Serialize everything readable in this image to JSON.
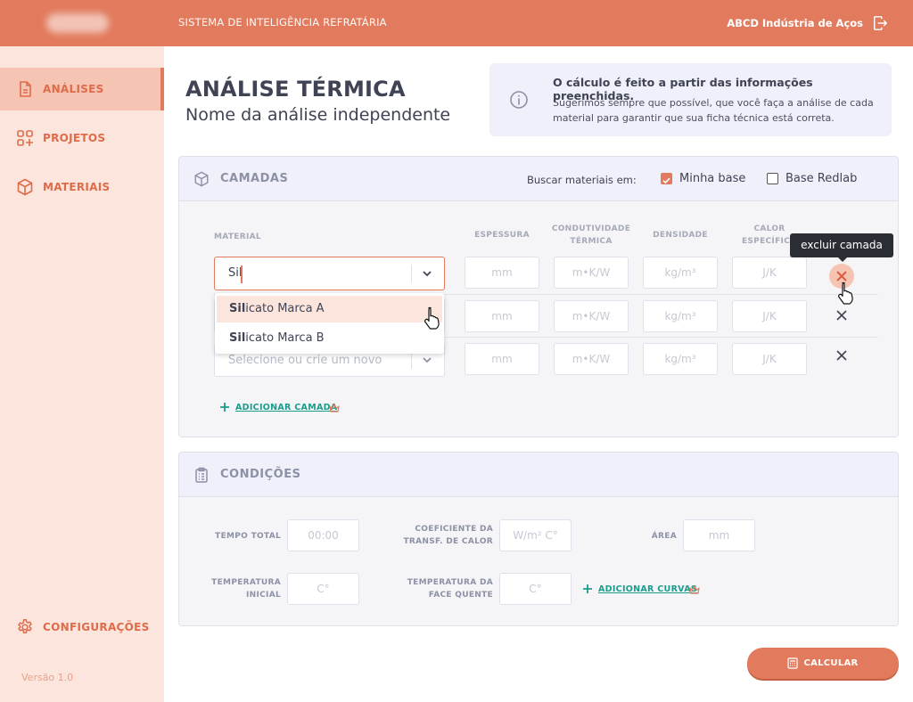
{
  "header": {
    "system_title": "SISTEMA DE INTELIGÊNCIA REFRATÁRIA",
    "company": "ABCD Indústria de Aços"
  },
  "sidebar": {
    "items": [
      {
        "label": "ANÁLISES",
        "icon": "document-icon",
        "active": true
      },
      {
        "label": "PROJETOS",
        "icon": "grid-plus-icon",
        "active": false
      },
      {
        "label": "MATERIAIS",
        "icon": "cube-icon",
        "active": false
      }
    ],
    "settings_label": "CONFIGURAÇÕES",
    "version": "Versão 1.0"
  },
  "page": {
    "title": "ANÁLISE TÉRMICA",
    "subtitle": "Nome da análise independente"
  },
  "info": {
    "title": "O cálculo é feito a partir das informações preenchidas.",
    "text": "Sugerimos sempre que possível, que você faça a análise de cada material para garantir que sua ficha técnica está correta."
  },
  "layers": {
    "title": "CAMADAS",
    "search_label": "Buscar materiais em:",
    "options": [
      {
        "label": "Minha base",
        "checked": true
      },
      {
        "label": "Base Redlab",
        "checked": false
      }
    ],
    "columns": {
      "material": "MATERIAL",
      "thickness": "ESPESSURA",
      "conductivity_1": "CONDUTIVIDADE",
      "conductivity_2": "TÉRMICA",
      "density": "DENSIDADE",
      "heat_1": "CALOR",
      "heat_2": "ESPECÍFICO"
    },
    "placeholders": {
      "thickness": "mm",
      "conductivity": "m•K/W",
      "density": "kg/m³",
      "heat": "J/K"
    },
    "rows": [
      {
        "material_value": "Sil"
      },
      {
        "material_value": ""
      },
      {
        "material_value": ""
      }
    ],
    "material_placeholder": "Selecione ou crie um novo",
    "suggestions": [
      {
        "match": "Sil",
        "rest": "icato Marca A"
      },
      {
        "match": "Sil",
        "rest": "icato Marca B"
      }
    ],
    "tooltip": "excluir camada",
    "add_label": "ADICIONAR CAMADA"
  },
  "conditions": {
    "title": "CONDIÇÕES",
    "fields": {
      "total_time": {
        "label_1": "TEMPO TOTAL",
        "placeholder": "00:00"
      },
      "coef": {
        "label_1": "COEFICIENTE DA",
        "label_2": "TRANSF. DE CALOR",
        "placeholder": "W/m² C°"
      },
      "area": {
        "label_1": "ÁREA",
        "placeholder": "mm"
      },
      "init_temp": {
        "label_1": "TEMPERATURA",
        "label_2": "INICIAL",
        "placeholder": "C°"
      },
      "hot_face": {
        "label_1": "TEMPERATURA DA",
        "label_2": "FACE QUENTE",
        "placeholder": "C°"
      }
    },
    "add_curves_label": "ADICIONAR CURVAS"
  },
  "actions": {
    "calculate_label": "CALCULAR"
  },
  "colors": {
    "brand": "#e27b5d",
    "sidebar_bg": "#fbe5dc",
    "link": "#1a9c8c"
  }
}
